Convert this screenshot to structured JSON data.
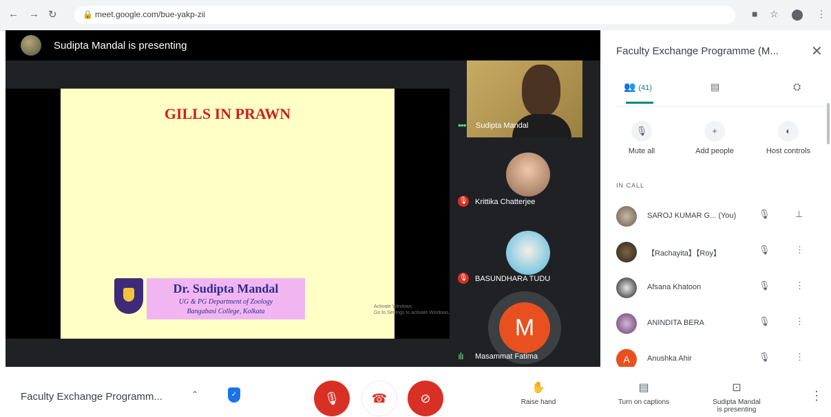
{
  "browser": {
    "url": "meet.google.com/bue-yakp-zii"
  },
  "stage": {
    "presenting_text": "Sudipta Mandal is presenting",
    "slide": {
      "title": "GILLS IN PRAWN",
      "name": "Dr. Sudipta Mandal",
      "dept": "UG & PG Department of Zoology",
      "college": "Bangabasi College, Kolkata"
    },
    "watermark": [
      "Activate Windows",
      "Go to Settings to activate Windows."
    ],
    "tiles": [
      {
        "name": "Sudipta Mandal"
      },
      {
        "name": "Krittika Chatterjee"
      },
      {
        "name": "BASUNDHARA TUDU"
      },
      {
        "name": "Masammat Fatima",
        "initial": "M"
      }
    ]
  },
  "panel": {
    "title": "Faculty Exchange Programme (M...",
    "people_count": "(41)",
    "actions": [
      "Mute all",
      "Add people",
      "Host controls"
    ],
    "in_call_label": "IN CALL",
    "participants": [
      {
        "name": "SAROJ KUMAR G...",
        "you": "(You)"
      },
      {
        "name": "【Rachayita】【Roy】"
      },
      {
        "name": "Afsana Khatoon"
      },
      {
        "name": "ANINDITA BERA"
      },
      {
        "name": "Anushka Ahir",
        "initial": "A"
      }
    ]
  },
  "bottom": {
    "meeting_name": "Faculty Exchange Programm...",
    "raise_hand": "Raise hand",
    "captions": "Turn on captions",
    "presenting": [
      "Sudipta Mandal",
      "is presenting"
    ]
  },
  "colors": {
    "red": "#d93025",
    "teal": "#00897b",
    "orange_avatar": "#e8501f"
  }
}
